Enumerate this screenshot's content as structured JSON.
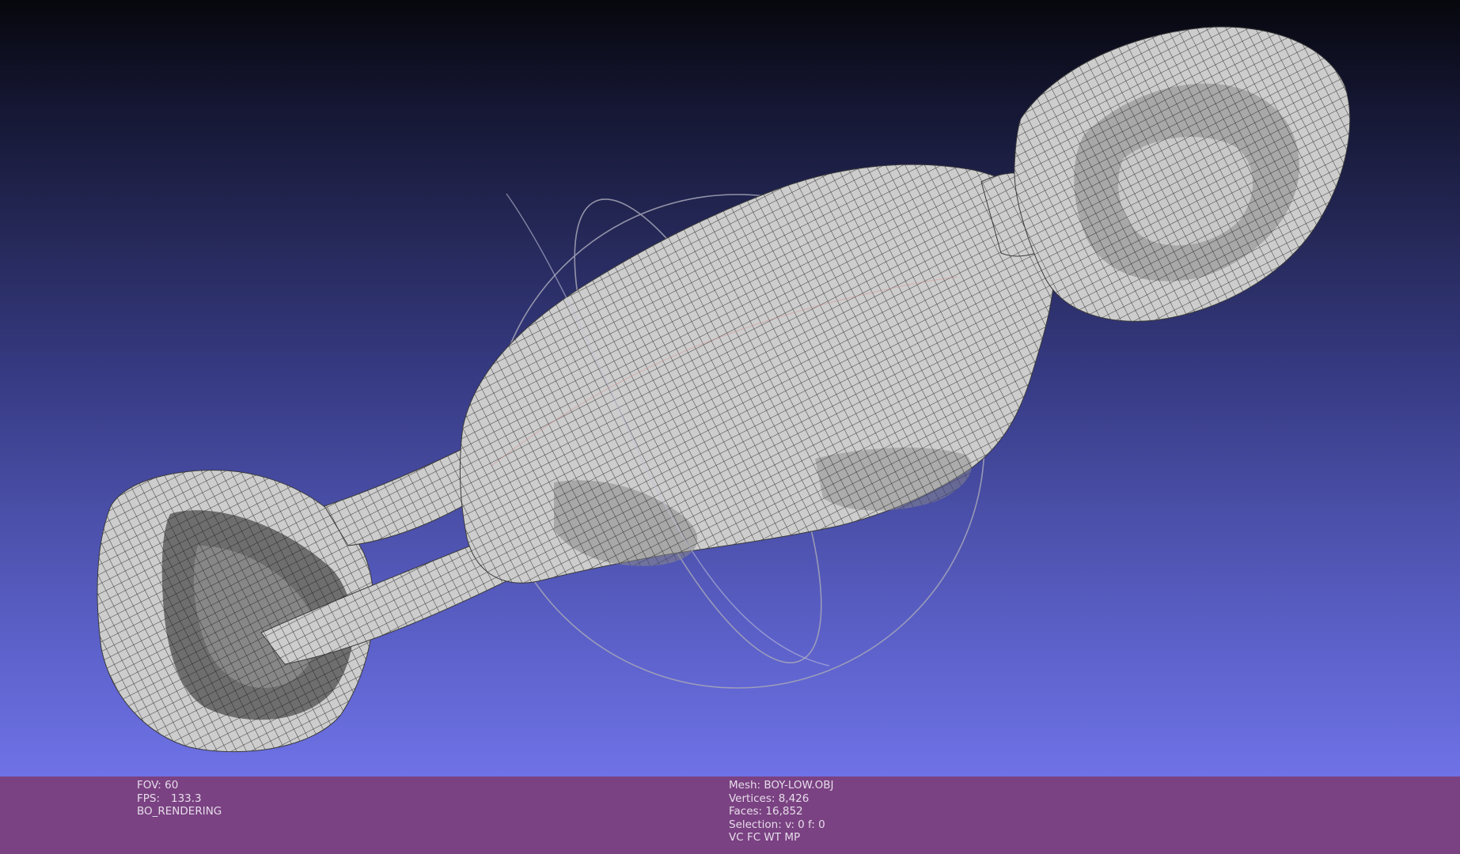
{
  "app": {
    "window": "MeshLab 3D viewport"
  },
  "render_info": {
    "fov_label": "FOV:",
    "fov_value": "60",
    "fps_label": "FPS:",
    "fps_value": "133.3",
    "render_mode": "BO_RENDERING"
  },
  "mesh_info": {
    "mesh_label": "Mesh:",
    "mesh_value": "BOY-LOW.OBJ",
    "vertices_label": "Vertices:",
    "vertices_value": "8,426",
    "faces_label": "Faces:",
    "faces_value": "16,852",
    "selection_label": "Selection:",
    "selection_value": "v: 0 f: 0",
    "flags": "VC FC WT MP"
  },
  "colors": {
    "statusbar_bg": "#7a4282",
    "mesh_fill": "#c9c9c9",
    "mesh_wire": "#3a3a3a",
    "trackball": "#a6a6b8"
  }
}
